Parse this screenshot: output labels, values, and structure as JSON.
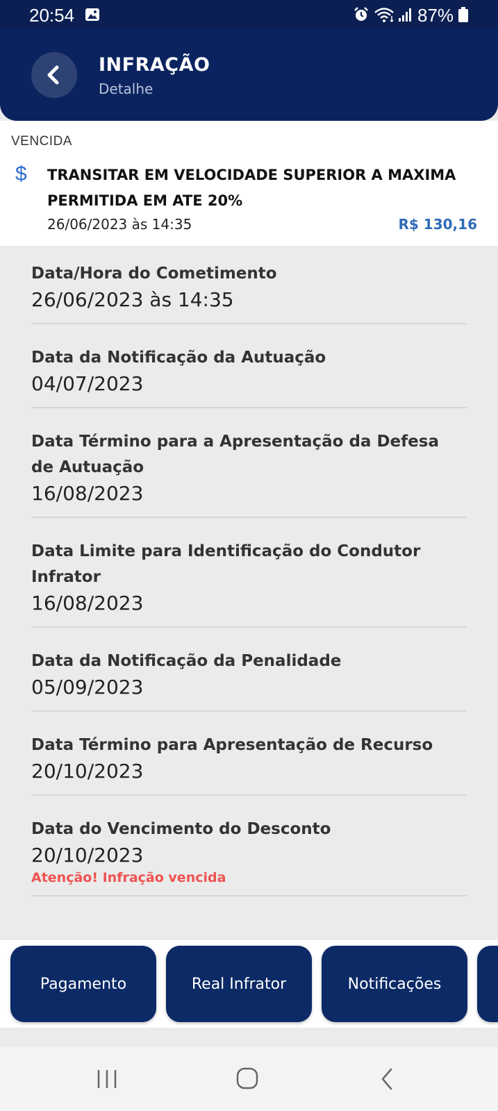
{
  "status_bar": {
    "time": "20:54",
    "battery": "87%",
    "icons": [
      "gallery-icon",
      "alarm-icon",
      "wifi-icon",
      "signal-icon",
      "battery-icon"
    ]
  },
  "header": {
    "title": "INFRAÇÃO",
    "subtitle": "Detalhe",
    "back_icon": "chevron-left-icon"
  },
  "summary": {
    "status": "VENCIDA",
    "icon": "dollar-icon",
    "title": "TRANSITAR EM VELOCIDADE SUPERIOR A MAXIMA PERMITIDA EM ATE 20%",
    "datetime": "26/06/2023 às 14:35",
    "amount": "R$ 130,16"
  },
  "details": [
    {
      "label": "Data/Hora do Cometimento",
      "value": "26/06/2023 às 14:35"
    },
    {
      "label": "Data da Notificação da Autuação",
      "value": "04/07/2023"
    },
    {
      "label": "Data Término para a Apresentação da Defesa de Autuação",
      "value": "16/08/2023"
    },
    {
      "label": "Data Limite para Identificação do Condutor Infrator",
      "value": "16/08/2023"
    },
    {
      "label": "Data da Notificação da Penalidade",
      "value": "05/09/2023"
    },
    {
      "label": "Data Término para Apresentação de Recurso",
      "value": "20/10/2023"
    },
    {
      "label": "Data do Vencimento do Desconto",
      "value": "20/10/2023",
      "warning": "Atenção! Infração vencida"
    }
  ],
  "actions": [
    "Pagamento",
    "Real Infrator",
    "Notificações",
    ""
  ],
  "colors": {
    "primary": "#0b2460",
    "accent": "#2f6bd0",
    "warning": "#ef5350",
    "background": "#ebebeb"
  },
  "nav": [
    "recent-apps-icon",
    "home-icon",
    "back-icon"
  ]
}
